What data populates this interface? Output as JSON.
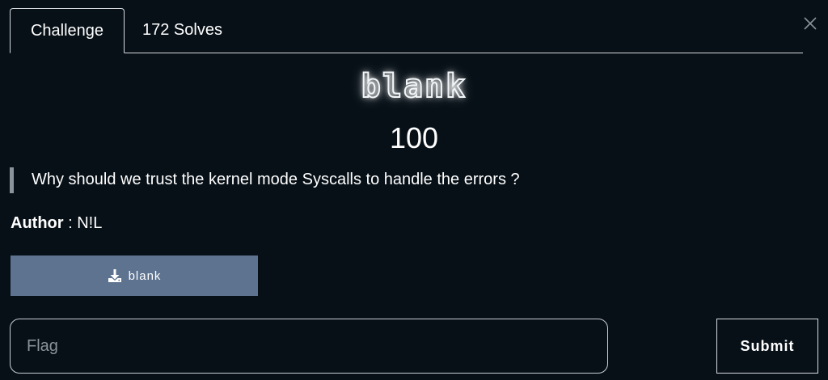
{
  "tabs": [
    {
      "label": "Challenge",
      "active": true
    },
    {
      "label": "172 Solves",
      "active": false
    }
  ],
  "close_icon": "close-icon",
  "challenge": {
    "name": "blank",
    "points": "100",
    "description": "Why should we trust the kernel mode Syscalls to handle the errors ?",
    "author_label": "Author",
    "author_separator": " : ",
    "author_name": "N!L"
  },
  "download": {
    "icon": "download-icon",
    "label": "blank"
  },
  "flag_form": {
    "placeholder": "Flag",
    "value": "",
    "submit_label": "Submit"
  },
  "colors": {
    "background": "#071017",
    "download_button": "#5d7390",
    "text": "#ffffff",
    "border": "#d7dbe0"
  }
}
